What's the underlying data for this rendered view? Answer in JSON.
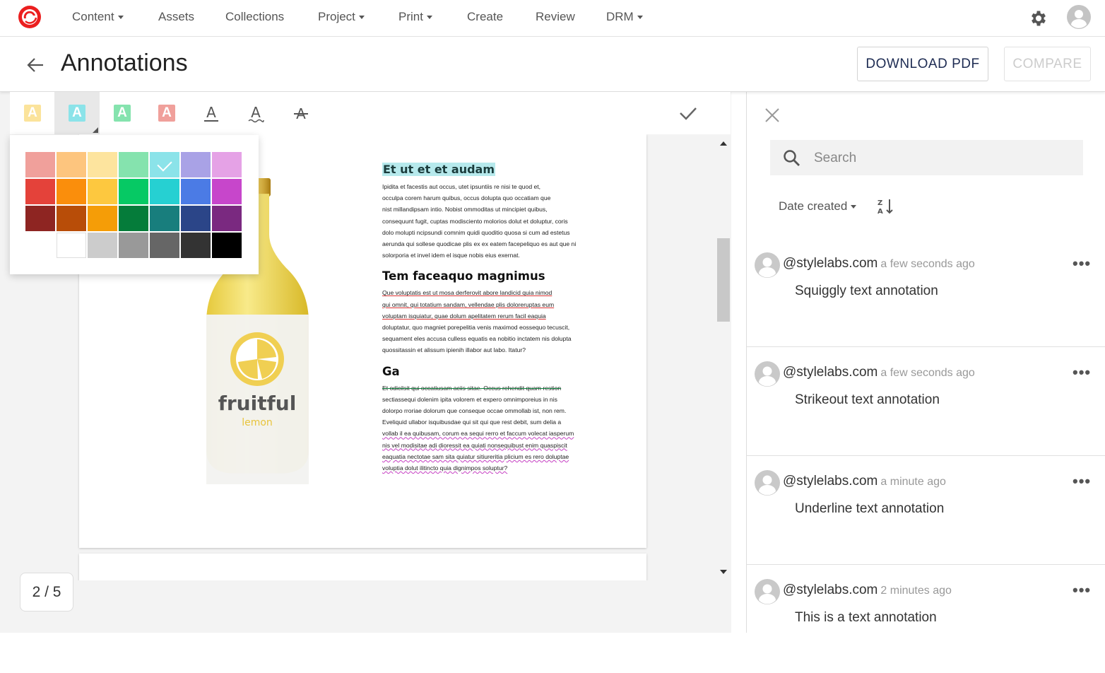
{
  "nav": {
    "items": [
      {
        "label": "Content",
        "dropdown": true
      },
      {
        "label": "Assets",
        "dropdown": false
      },
      {
        "label": "Collections",
        "dropdown": false
      },
      {
        "label": "Project",
        "dropdown": true
      },
      {
        "label": "Print",
        "dropdown": true
      },
      {
        "label": "Create",
        "dropdown": false
      },
      {
        "label": "Review",
        "dropdown": false
      },
      {
        "label": "DRM",
        "dropdown": true
      }
    ],
    "logo_icon": "sitecore-logo",
    "settings_icon": "gear-icon",
    "account_icon": "user-avatar-icon"
  },
  "header": {
    "title": "Annotations",
    "download_label": "DOWNLOAD PDF",
    "compare_label": "COMPARE"
  },
  "toolbar": {
    "tools": [
      {
        "name": "highlight-yellow",
        "glyph": "A",
        "color": "#fbe39b"
      },
      {
        "name": "highlight-cyan",
        "glyph": "A",
        "color": "#8be3e9",
        "active": true
      },
      {
        "name": "highlight-green",
        "glyph": "A",
        "color": "#85e3ae"
      },
      {
        "name": "highlight-red",
        "glyph": "A",
        "color": "#f0a09b"
      },
      {
        "name": "underline",
        "glyph": "A"
      },
      {
        "name": "squiggly",
        "glyph": "A"
      },
      {
        "name": "strikeout",
        "glyph": "A"
      }
    ],
    "confirm_icon": "check-icon"
  },
  "palette": {
    "rows": [
      [
        "#f0a09b",
        "#fdc57e",
        "#fde49e",
        "#85e3ae",
        "#8be3e9",
        "#a9a2e6",
        "#e5a2e6"
      ],
      [
        "#e4423a",
        "#fa8e0c",
        "#fdc83f",
        "#06c964",
        "#26d0d2",
        "#4b7be5",
        "#c746cb"
      ],
      [
        "#8e2522",
        "#b84d08",
        "#f59d07",
        "#057c3a",
        "#187e7d",
        "#2b4588",
        "#7a2980"
      ],
      [
        null,
        "#ffffff",
        "#cccccc",
        "#999999",
        "#666666",
        "#333333",
        "#000000"
      ]
    ],
    "selected": "#8be3e9"
  },
  "document": {
    "page_indicator": "2 / 5",
    "bottle_brand": "fruitful",
    "bottle_flavor": "lemon",
    "heading1": "Et ut et et audam",
    "para1": [
      "Ipidita et facestis aut occus, utet ipsuntiis re nisi te quod et,",
      "occulpa corem harum quibus, occus dolupta quo occatiam que",
      "nist millandipsam intio. Nobist ommoditas ut mincipiet quibus,",
      "consequunt fugit, cuptas modisciento molorios dolut et doluptur, coris",
      "dolo molupti ncipsundi comnim quidi quoditio quosa si cum ad estetus",
      "aerunda qui sollese quodicae plis ex ex eatem facepeliquo es aut que ni",
      "solorporia et invel idem el isque nobis eius exernat."
    ],
    "heading2": "Tem faceaquo magnimus",
    "para2_underlined": [
      "Que voluptatis est ut mosa derferovit abore landicid quia nimod",
      "qui omnit, qui totatium sandam, vellendae plis doloreruptas eum",
      "voluptam isquiatur, quae dolum apelitatem rerum facil eaquia"
    ],
    "para2_plain": [
      "doluptatur, quo magniet porepelitia venis maximod eossequo tecuscit,",
      "sequament eles accusa culless equatis ea nobitio inctatem nis dolupta",
      "quossitassin et alissum ipienih illabor aut labo. Itatur?"
    ],
    "heading3": "Ga",
    "para3_strike": "Et odicilsit qui occatiusam aciis sitae. Occus rehendit quam restion",
    "para3_plain": [
      "sectiassequi dolenim ipita volorem et expero omnimporeius in nis",
      "dolorpo rroriae dolorum que conseque occae ommollab ist, non rem.",
      "Eveliquid ullabor isquibusdae qui sit qui que rest debit, sum delia a"
    ],
    "para3_squiggly": [
      "vollab il ea quibusam, corum ea sequi rerro et faccum volecat iasperum",
      "nis vel modisitae adi dioressit ea quiati nonsequibust enim quaspiscit",
      "eaquatia nectotae sam sita quiatur sitiureritia plicium es rero doluptae",
      "voluptia dolut ilitincto quia dignimpos soluptur?"
    ]
  },
  "panel": {
    "close_icon": "close-icon",
    "search_placeholder": "Search",
    "sort_label": "Date created",
    "sort_icon": "sort-za-icon",
    "comments": [
      {
        "user": "@stylelabs.com",
        "time": "a few seconds ago",
        "text": "Squiggly text annotation"
      },
      {
        "user": "@stylelabs.com",
        "time": "a few seconds ago",
        "text": "Strikeout text annotation"
      },
      {
        "user": "@stylelabs.com",
        "time": "a minute ago",
        "text": "Underline text annotation"
      },
      {
        "user": "@stylelabs.com",
        "time": "2 minutes ago",
        "text": "This is a text annotation"
      }
    ],
    "more_label": "•••"
  }
}
